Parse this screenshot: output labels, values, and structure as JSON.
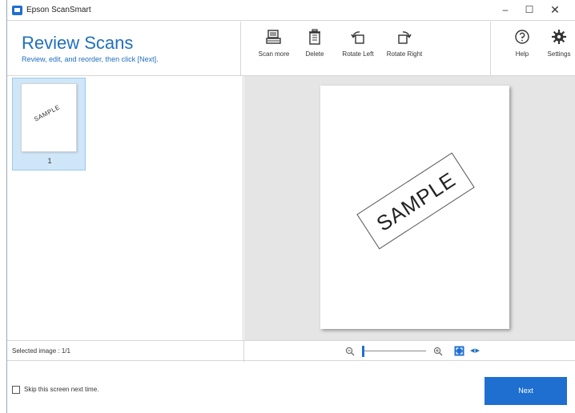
{
  "window": {
    "title": "Epson ScanSmart",
    "minimize": "–",
    "maximize": "☐",
    "close": "✕"
  },
  "header": {
    "title": "Review Scans",
    "subtitle": "Review, edit, and reorder, then click [Next]."
  },
  "toolbar": {
    "items": [
      {
        "label": "Scan more",
        "icon": "scanner-icon"
      },
      {
        "label": "Delete",
        "icon": "trash-icon"
      },
      {
        "label": "Rotate Left",
        "icon": "rotate-left-icon"
      },
      {
        "label": "Rotate Right",
        "icon": "rotate-right-icon"
      },
      {
        "label": "Help",
        "icon": "help-icon"
      },
      {
        "label": "Settings",
        "icon": "gear-icon"
      }
    ]
  },
  "thumbnails": [
    {
      "label": "1",
      "content": "SAMPLE",
      "selected": true
    }
  ],
  "preview": {
    "content": "SAMPLE"
  },
  "status": {
    "selected_image": "Selected image : 1/1",
    "zoom_level": 0
  },
  "footer": {
    "skip_label": "Skip this screen next time.",
    "skip_checked": false,
    "next_label": "Next"
  },
  "colors": {
    "accent": "#1f6fd0",
    "title_text": "#1f6fbf",
    "selection_bg": "#cfe6f8",
    "preview_bg": "#e5e5e5"
  }
}
